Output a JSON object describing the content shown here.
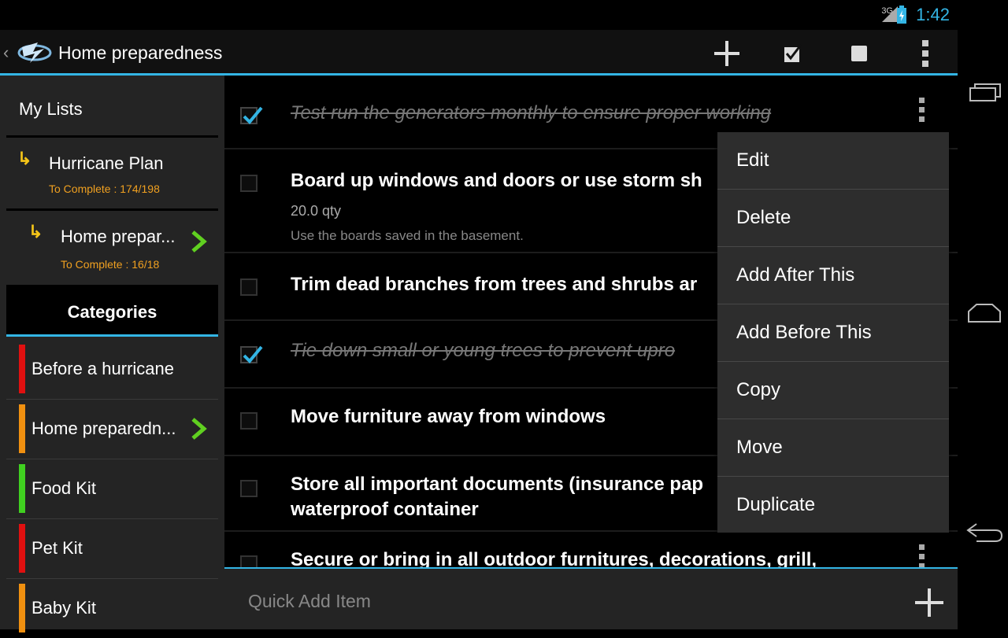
{
  "status": {
    "network": "3G",
    "time": "1:42"
  },
  "actionbar": {
    "title": "Home preparedness"
  },
  "sidebar": {
    "header": "My Lists",
    "lists": [
      {
        "name": "Hurricane Plan",
        "count": "To Complete : 174/198"
      },
      {
        "name": "Home prepar...",
        "count": "To Complete : 16/18"
      }
    ],
    "categories_title": "Categories",
    "categories": [
      {
        "name": "Before a hurricane",
        "color": "#e01010"
      },
      {
        "name": "Home preparedn...",
        "color": "#f09010"
      },
      {
        "name": "Food Kit",
        "color": "#40d020"
      },
      {
        "name": "Pet Kit",
        "color": "#e01010"
      },
      {
        "name": "Baby Kit",
        "color": "#f09010"
      }
    ]
  },
  "items": [
    {
      "text": "Test run the generators monthly to ensure proper working",
      "done": true
    },
    {
      "text": "Board up windows and doors or use storm sh",
      "qty": "20.0 qty",
      "note": "Use the boards saved in the basement.",
      "done": false
    },
    {
      "text": "Trim dead branches from trees and shrubs ar",
      "done": false
    },
    {
      "text": "Tie down small or young trees to prevent upro",
      "done": true
    },
    {
      "text": "Move furniture away from windows",
      "done": false
    },
    {
      "text": "Store all important documents (insurance pap waterproof container",
      "done": false
    },
    {
      "text": "Secure or bring in all outdoor furnitures, decorations, grill,",
      "done": false
    }
  ],
  "menu": [
    "Edit",
    "Delete",
    "Add After This",
    "Add Before This",
    "Copy",
    "Move",
    "Duplicate"
  ],
  "quickadd": {
    "placeholder": "Quick Add Item"
  },
  "accent": "#33b5e5"
}
